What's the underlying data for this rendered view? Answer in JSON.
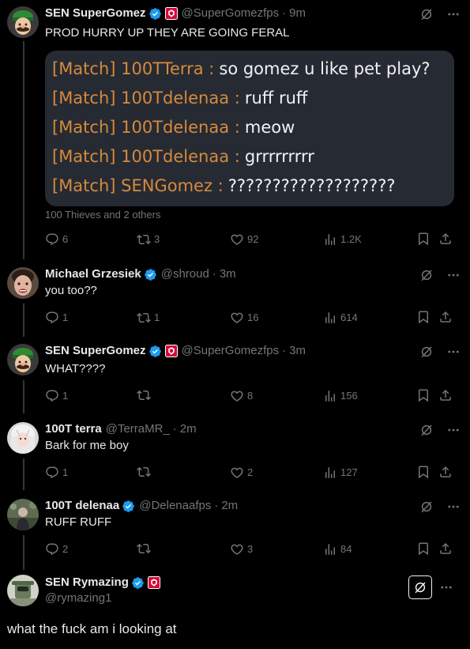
{
  "tweets": [
    {
      "name": "SEN SuperGomez",
      "handle": "@SuperGomezfps",
      "sep": "·",
      "time": "9m",
      "text": "PROD HURRY UP THEY ARE GOING FERAL",
      "media": {
        "chat": [
          {
            "prefix": "[Match] 100TTerra :",
            "msg": "so gomez u like pet play?"
          },
          {
            "prefix": "[Match] 100Tdelenaa :",
            "msg": "ruff ruff"
          },
          {
            "prefix": "[Match] 100Tdelenaa :",
            "msg": "meow"
          },
          {
            "prefix": "[Match] 100Tdelenaa :",
            "msg": "grrrrrrrrr"
          },
          {
            "prefix": "[Match] SENGomez :",
            "msg": "???????????????????"
          }
        ],
        "tagged": "100 Thieves and 2 others"
      },
      "replies": "6",
      "reposts": "3",
      "likes": "92",
      "views": "1.2K"
    },
    {
      "name": "Michael Grzesiek",
      "handle": "@shroud",
      "sep": "·",
      "time": "3m",
      "text": "you too??",
      "replies": "1",
      "reposts": "1",
      "likes": "16",
      "views": "614"
    },
    {
      "name": "SEN SuperGomez",
      "handle": "@SuperGomezfps",
      "sep": "·",
      "time": "3m",
      "text": "WHAT????",
      "replies": "1",
      "reposts": "",
      "likes": "8",
      "views": "156"
    },
    {
      "name": "100T terra",
      "handle": "@TerraMR_",
      "sep": "·",
      "time": "2m",
      "text": "Bark for me boy",
      "replies": "1",
      "reposts": "",
      "likes": "2",
      "views": "127"
    },
    {
      "name": "100T delenaa",
      "handle": "@Delenaafps",
      "sep": "·",
      "time": "2m",
      "text": "RUFF RUFF",
      "replies": "2",
      "reposts": "",
      "likes": "3",
      "views": "84"
    }
  ],
  "focused": {
    "name": "SEN Rymazing",
    "handle": "@rymazing1",
    "text": "what the fuck am i looking at"
  },
  "colors": {
    "background": "#000000",
    "text": "#e7e9ea",
    "muted": "#71767b",
    "verified": "#1d9bf0",
    "affiliate": "#d4093a",
    "chat_prefix": "#d68a3c"
  },
  "icons": [
    "verified-badge-icon",
    "affiliate-badge-icon",
    "grok-icon",
    "more-icon",
    "reply-icon",
    "repost-icon",
    "like-icon",
    "views-icon",
    "bookmark-icon",
    "share-icon"
  ]
}
